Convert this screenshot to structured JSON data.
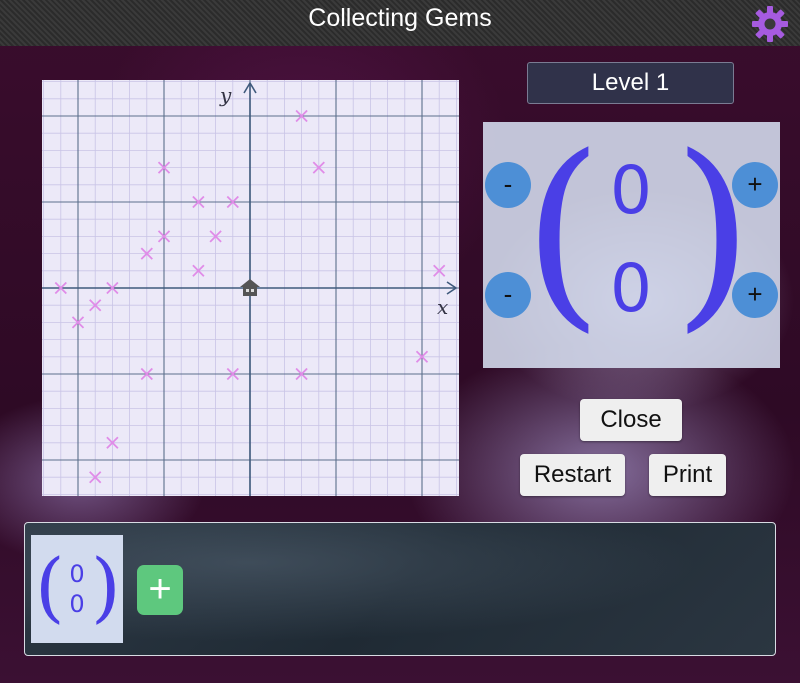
{
  "app": {
    "title": "Collecting Gems"
  },
  "header": {
    "settings_icon": "gear-icon"
  },
  "graph": {
    "x_label": "x",
    "y_label": "y",
    "x_range": [
      -12,
      12
    ],
    "y_range": [
      -12,
      12
    ],
    "home_icon": "house-icon",
    "home": [
      0,
      0
    ],
    "gems": [
      [
        3,
        10
      ],
      [
        -5,
        7
      ],
      [
        4,
        7
      ],
      [
        -3,
        5
      ],
      [
        -1,
        5
      ],
      [
        -5,
        3
      ],
      [
        -2,
        3
      ],
      [
        -6,
        2
      ],
      [
        -3,
        1
      ],
      [
        -8,
        0
      ],
      [
        -11,
        0
      ],
      [
        -9,
        -1
      ],
      [
        -10,
        -2
      ],
      [
        11,
        1
      ],
      [
        10,
        -4
      ],
      [
        -6,
        -5
      ],
      [
        -1,
        -5
      ],
      [
        3,
        -5
      ],
      [
        -8,
        -9
      ],
      [
        -9,
        -11
      ]
    ],
    "colors": {
      "gem": "#e08ce8",
      "axis": "#3f5a7c",
      "major_grid": "#5b6f8c",
      "minor_grid": "#c9c4e6"
    }
  },
  "level": {
    "label": "Level 1"
  },
  "vector": {
    "x": "0",
    "y": "0",
    "minus": "-",
    "plus": "+"
  },
  "buttons": {
    "close": "Close",
    "restart": "Restart",
    "print": "Print"
  },
  "tray": {
    "cards": [
      {
        "x": "0",
        "y": "0"
      }
    ],
    "add_label": "+"
  },
  "theme": {
    "accent": "#4a3fe6",
    "control_blue": "#4d8fd6",
    "add_green": "#5ec87e"
  }
}
